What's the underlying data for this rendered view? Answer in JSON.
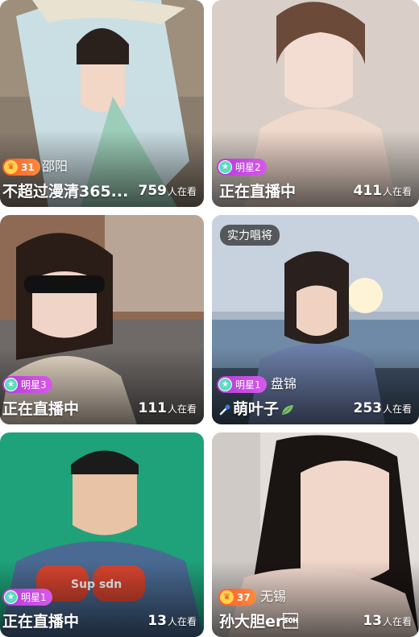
{
  "cards": [
    {
      "location": "邵阳",
      "title": "不超过漫清365...",
      "viewers": "759",
      "viewers_suffix": "人在看",
      "badge_text": "31",
      "badge_kind": "level"
    },
    {
      "location": "",
      "title": "正在直播中",
      "viewers": "411",
      "viewers_suffix": "人在看",
      "badge_text": "明星2",
      "badge_kind": "star"
    },
    {
      "location": "",
      "title": "正在直播中",
      "viewers": "111",
      "viewers_suffix": "人在看",
      "badge_text": "明星3",
      "badge_kind": "star"
    },
    {
      "top_tag": "实力唱将",
      "location": "盘锦",
      "title": "萌叶子",
      "viewers": "253",
      "viewers_suffix": "人在看",
      "badge_text": "明星1",
      "badge_kind": "star"
    },
    {
      "location": "",
      "title": "正在直播中",
      "viewers": "13",
      "viewers_suffix": "人在看",
      "badge_text": "明星1",
      "badge_kind": "star"
    },
    {
      "location": "无锡",
      "title": "孙大胆er\u0001",
      "viewers": "13",
      "viewers_suffix": "人在看",
      "badge_text": "37",
      "badge_kind": "level"
    }
  ],
  "colors": {
    "level_badge": "#ff5a2a",
    "star_badge": "#c04ddf",
    "tag_bg": "#2a2a2a"
  }
}
